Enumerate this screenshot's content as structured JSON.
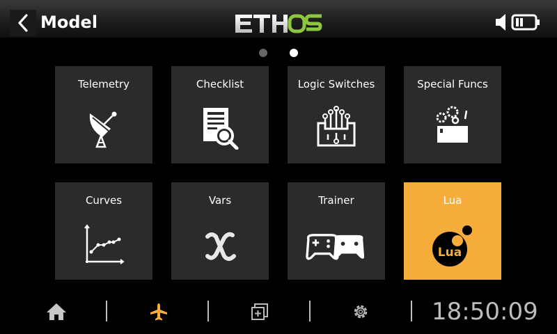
{
  "header": {
    "title": "Model",
    "logo_text": "ETHOS",
    "back_icon": "chevron-left-icon",
    "status_icons": [
      "speaker-icon",
      "battery-icon"
    ]
  },
  "pager": {
    "pages": 2,
    "current": 2
  },
  "tiles": [
    {
      "label": "Telemetry",
      "icon": "satellite-dish-icon",
      "selected": false
    },
    {
      "label": "Checklist",
      "icon": "checklist-icon",
      "selected": false
    },
    {
      "label": "Logic Switches",
      "icon": "logic-circuit-icon",
      "selected": false
    },
    {
      "label": "Special Funcs",
      "icon": "gears-icon",
      "selected": false
    },
    {
      "label": "Curves",
      "icon": "curve-graph-icon",
      "selected": false
    },
    {
      "label": "Vars",
      "icon": "variable-x-icon",
      "selected": false
    },
    {
      "label": "Trainer",
      "icon": "gamepads-icon",
      "selected": false
    },
    {
      "label": "Lua",
      "icon": "lua-logo-icon",
      "icon_text": "Lua",
      "selected": true
    }
  ],
  "bottom_nav": {
    "items": [
      "home-icon",
      "airplane-icon",
      "screens-icon",
      "settings-icon"
    ],
    "active": "airplane-icon",
    "clock": "18:50:09"
  },
  "colors": {
    "accent": "#f7ad3b",
    "logo_green": "#8dc63f",
    "tile_bg": "#2b2b2b"
  }
}
